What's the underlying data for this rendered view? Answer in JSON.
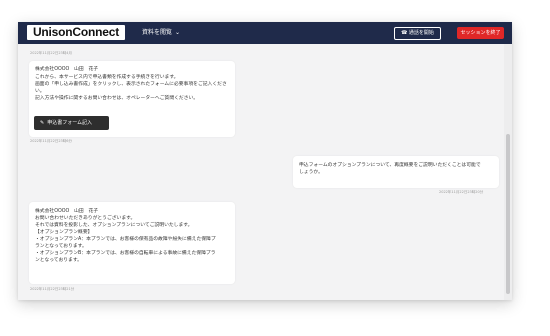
{
  "header": {
    "logo": "UnisonConnect",
    "menu_label": "資料を閲覧",
    "tel_label": "通話を開始",
    "end_label": "セッションを終了"
  },
  "messages": [
    {
      "timestamp": "2022年11月22日23時4月",
      "sender": "株式会社OOOO　山田　花子",
      "lines": [
        "これから、本サービス内で申込書類を作成する手続きを行います。",
        "画面の「申し込み書作成」をクリックし、表示されたフォームに必要事項をご記入くださ",
        "い。",
        "記入方法や操作に関するお問い合わせは、オペレーターへご質問ください。"
      ],
      "button_label": "申込書フォーム記入",
      "footer_timestamp": "2022年11月22日23時6分"
    },
    {
      "text_lines": [
        "申込フォームのオプションプランについて、再度概要をご説明いただくことは可能で",
        "しょうか。"
      ],
      "timestamp": "2022年11月22日23時20分"
    },
    {
      "sender": "株式会社OOOO　山田　花子",
      "lines": [
        "お問い合わせいただきありがとうございます。",
        "それでは資料を投影した、オプションプランについてご説明いたします。",
        "【オプションプラン概要】",
        "・オプションプランA：本プランでは、お客様の保有品の故障や紛失に備えた保障プ",
        "ランとなっております。",
        "・オプションプランB：本プランでは、お客様の自転車による事故に備えた保障プラ",
        "ンとなっております。"
      ],
      "footer_timestamp": "2022年11月22日23時21分"
    }
  ],
  "colors": {
    "header_bg": "#1f2a4a",
    "end_button": "#e02727",
    "chat_bg": "#f3f3f4"
  }
}
